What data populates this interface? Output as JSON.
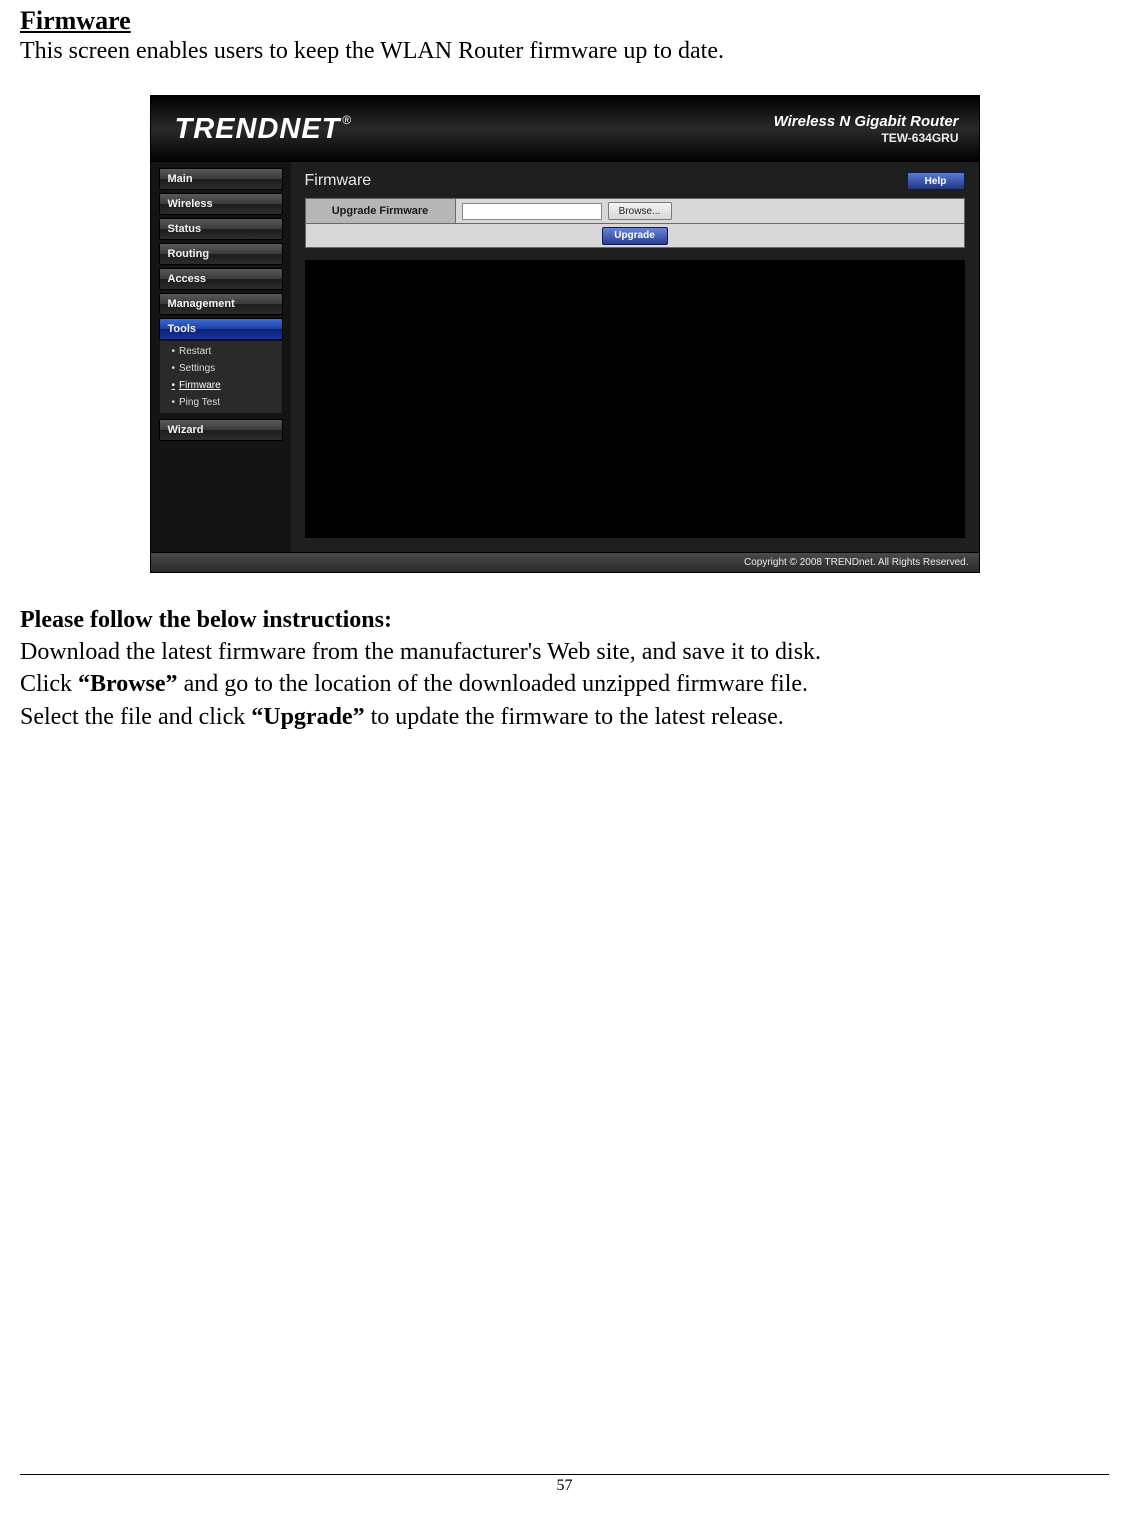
{
  "doc": {
    "title": "Firmware",
    "intro": "This screen enables users to keep the WLAN Router firmware up to date.",
    "instructions_heading": "Please follow the below instructions:",
    "line1": "Download the latest firmware from the manufacturer's Web site, and save it to disk.",
    "line2a": "Click ",
    "line2b": "“Browse”",
    "line2c": " and go to the location of the downloaded unzipped firmware file.",
    "line3a": "Select the file and click ",
    "line3b": "“Upgrade”",
    "line3c": " to update the firmware to the latest release.",
    "page_number": "57"
  },
  "ui": {
    "brand_main": "TREND",
    "brand_net": "NET",
    "brand_r": "®",
    "header_line1": "Wireless N Gigabit Router",
    "header_line2": "TEW-634GRU",
    "nav": {
      "main": "Main",
      "wireless": "Wireless",
      "status": "Status",
      "routing": "Routing",
      "access": "Access",
      "management": "Management",
      "tools": "Tools",
      "wizard": "Wizard"
    },
    "tools_sub": {
      "restart": "Restart",
      "settings": "Settings",
      "firmware": "Firmware",
      "pingtest": "Ping Test"
    },
    "content": {
      "title": "Firmware",
      "help": "Help",
      "upgrade_label": "Upgrade Firmware",
      "browse": "Browse...",
      "upgrade_btn": "Upgrade",
      "file_value": ""
    },
    "footer": "Copyright © 2008 TRENDnet. All Rights Reserved."
  }
}
